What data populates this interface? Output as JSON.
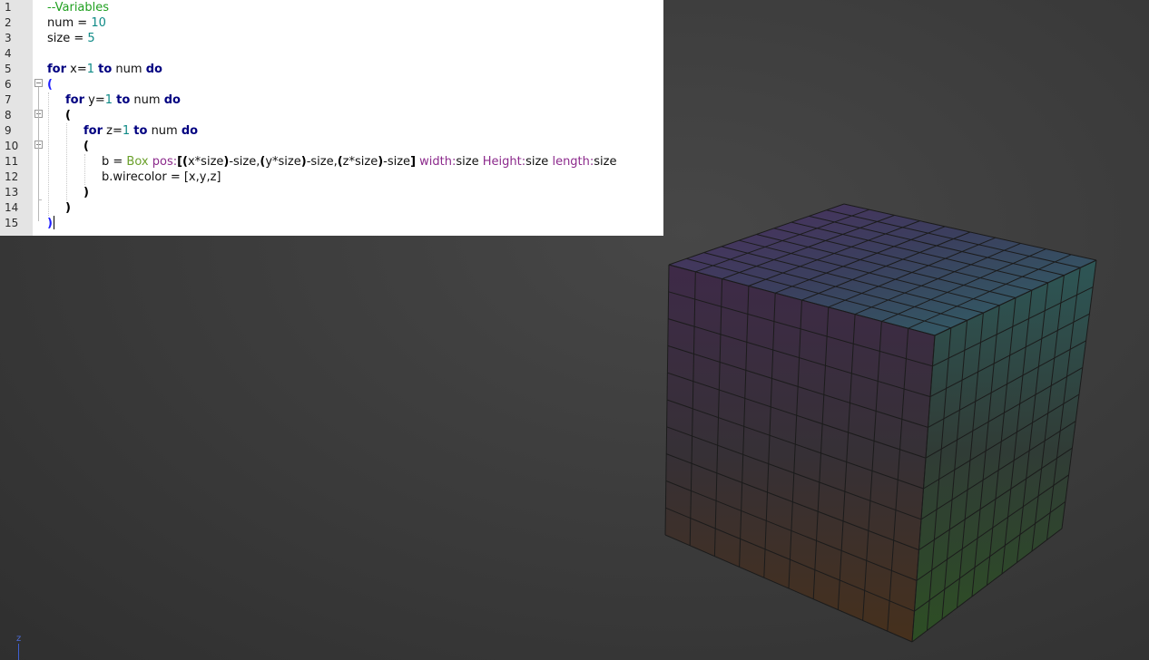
{
  "editor": {
    "line_numbers": [
      "1",
      "2",
      "3",
      "4",
      "5",
      "6",
      "7",
      "8",
      "9",
      "10",
      "11",
      "12",
      "13",
      "14",
      "15"
    ],
    "code": {
      "l1": "--Variables",
      "l2": {
        "var": "num = ",
        "val": "10"
      },
      "l3": {
        "var": "size = ",
        "val": "5"
      },
      "l5": {
        "kw1": "for",
        "var": " x=",
        "val": "1",
        "kw2": "to",
        "mid": " num ",
        "kw3": "do"
      },
      "l6": "(",
      "l7": {
        "kw1": "for",
        "var": " y=",
        "val": "1",
        "kw2": "to",
        "mid": " num ",
        "kw3": "do"
      },
      "l8": "(",
      "l9": {
        "kw1": "for",
        "var": " z=",
        "val": "1",
        "kw2": "to",
        "mid": " num ",
        "kw3": "do"
      },
      "l10": "(",
      "l11": {
        "a": "b = ",
        "cls": "Box",
        "p1": "pos:",
        "b1": "[(",
        "t1": "x*size",
        "b2": ")",
        "t2": "-size,",
        "b3": "(",
        "t3": "y*size",
        "b4": ")",
        "t4": "-size,",
        "b5": "(",
        "t5": "z*size",
        "b6": ")",
        "t6": "-size",
        "b7": "]",
        "p2": "width:",
        "v2": "size",
        "p3": "Height:",
        "v3": "size",
        "p4": "length:",
        "v4": "size"
      },
      "l12": "b.wirecolor = [x,y,z]",
      "l13": ")",
      "l14": ")",
      "l15": ")"
    }
  },
  "viewport": {
    "axis_label": "z",
    "cube_grid": 10,
    "colors": {
      "top_corner_far": "#3c4e78",
      "top_corner_left": "#4a2f5a",
      "top_corner_right": "#2f6a6a",
      "front_top": "#383838",
      "front_bottom": "#464a2a",
      "left_bottom": "#4a321c",
      "right_bottom": "#2f5a26",
      "edge": "#1c1c1c"
    }
  }
}
